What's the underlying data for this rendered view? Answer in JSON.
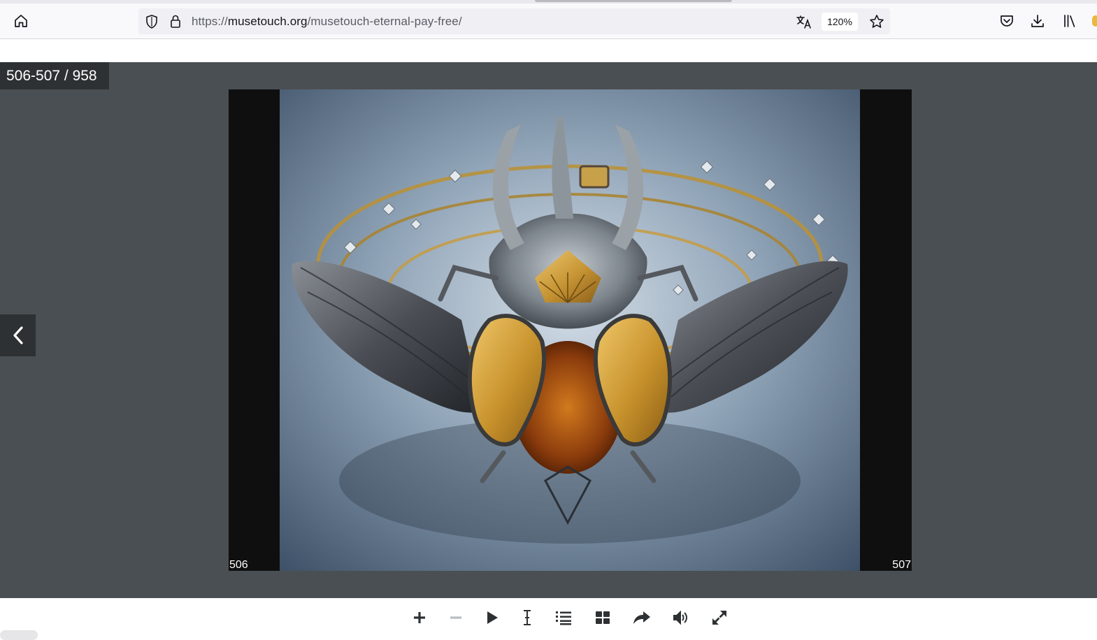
{
  "browser": {
    "url_prefix": "https://",
    "url_host": "musetouch.org",
    "url_path": "/musetouch-eternal-pay-free/",
    "zoom_level": "120%",
    "icons": {
      "home": "home-icon",
      "shield": "shield-icon",
      "lock": "lock-icon",
      "translate": "translate-icon",
      "bookmark": "star-icon",
      "pocket": "pocket-icon",
      "downloads": "download-icon",
      "library": "library-icon"
    }
  },
  "viewer": {
    "page_counter": "506-507 / 958",
    "left_page_number": "506",
    "right_page_number": "507",
    "photo_subject": "beetle-necklace-photo"
  },
  "toolbar": {
    "buttons": [
      "zoom-in-icon",
      "zoom-out-icon",
      "play-icon",
      "text-cursor-icon",
      "table-of-contents-icon",
      "thumbnails-icon",
      "share-icon",
      "sound-icon",
      "fullscreen-icon"
    ]
  },
  "colors": {
    "viewer_background": "#4a4f53",
    "counter_background": "#2e3133",
    "spread_background": "#0f0f0f",
    "accent_gold": "#c89a30"
  }
}
